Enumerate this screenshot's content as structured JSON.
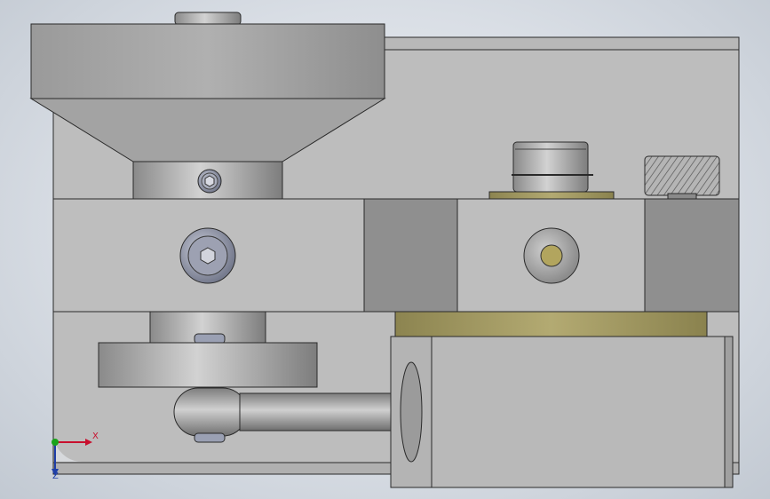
{
  "viewport": {
    "background_center": "#eef1f5",
    "background_edge": "#c2c9d2"
  },
  "colors": {
    "body_light": "#bdbdbd",
    "body_mid": "#a4a4a4",
    "body_dark": "#7a7a7a",
    "edge": "#2a2a2a",
    "brass": "#a39a62",
    "screw": "#8f95a8",
    "axis_x": "#c8102e",
    "axis_y": "#19a319",
    "axis_z": "#1f3fa8"
  },
  "icons": [
    "hex-socket-screw-icon",
    "hex-bolt-icon",
    "washer-hole-icon",
    "knurled-knob-icon",
    "view-triad-icon"
  ],
  "triad": {
    "x_label": "X",
    "z_label": "Z"
  }
}
